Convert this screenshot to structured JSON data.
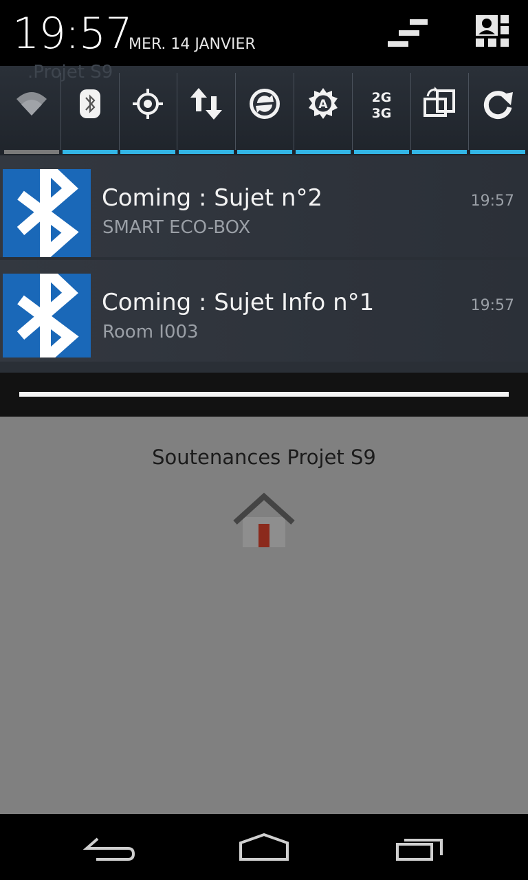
{
  "status_header": {
    "time": "19:57",
    "date": "MER. 14 JANVIER",
    "settings_icon": "settings-toggle-icon",
    "profile_icon": "profile-icon"
  },
  "quick_settings": {
    "background_app_label": ".Projet S9",
    "tiles": [
      {
        "name": "wifi",
        "icon": "wifi-icon",
        "active": false
      },
      {
        "name": "bluetooth",
        "icon": "bluetooth-icon",
        "active": true
      },
      {
        "name": "gps",
        "icon": "gps-icon",
        "active": true
      },
      {
        "name": "mobile-data",
        "icon": "data-arrows-icon",
        "active": true
      },
      {
        "name": "sync",
        "icon": "sync-icon",
        "active": true
      },
      {
        "name": "auto-brightness",
        "icon": "brightness-auto-icon",
        "active": true
      },
      {
        "name": "network-mode",
        "icon": "2g-3g-icon",
        "active": true,
        "label_top": "2G",
        "label_bottom": "3G"
      },
      {
        "name": "auto-rotate",
        "icon": "rotate-icon",
        "active": true
      },
      {
        "name": "refresh",
        "icon": "refresh-icon",
        "active": true
      }
    ],
    "active_color": "#33b5e5",
    "inactive_color": "#7a7a7a"
  },
  "notifications": [
    {
      "icon": "bluetooth-icon",
      "title": "Coming : Sujet n°2",
      "subtitle": "SMART ECO-BOX",
      "time": "19:57"
    },
    {
      "icon": "bluetooth-icon",
      "title": "Coming : Sujet Info n°1",
      "subtitle": "Room I003",
      "time": "19:57"
    }
  ],
  "app": {
    "title": "Soutenances Projet S9",
    "icon": "home-icon",
    "background": "#808080"
  },
  "navigation": {
    "back_icon": "back-icon",
    "home_icon": "home-nav-icon",
    "recents_icon": "recents-icon"
  }
}
